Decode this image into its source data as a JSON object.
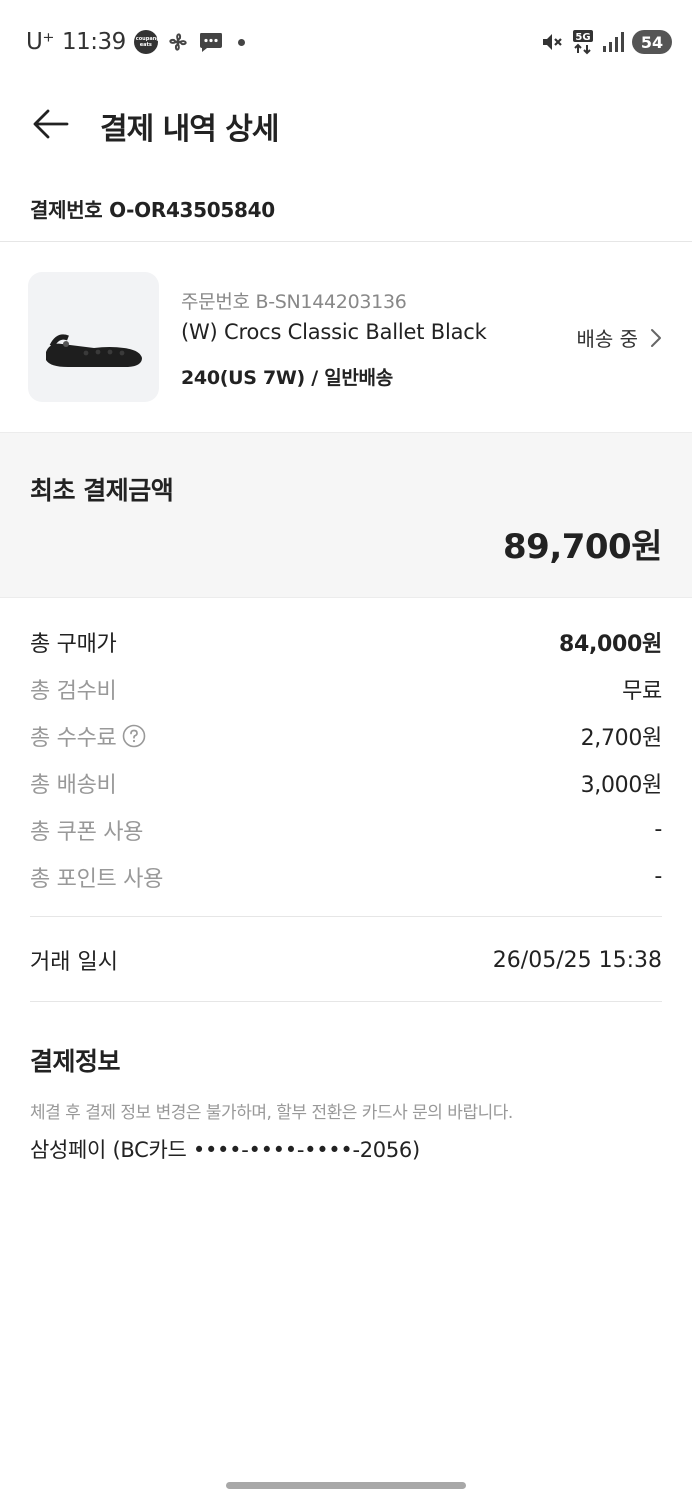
{
  "status_bar": {
    "carrier": "U⁺",
    "time": "11:39",
    "eats_icon_text": "coupang eats",
    "battery": "54",
    "icons": [
      "eats-icon",
      "pinwheel-icon",
      "chat-icon",
      "notification-dot-icon",
      "mute-icon",
      "5g-icon",
      "signal-icon",
      "battery-icon"
    ]
  },
  "header": {
    "title": "결제 내역 상세",
    "back_icon": "arrow-left-icon"
  },
  "payment": {
    "number": "결제번호 O-OR43505840"
  },
  "product": {
    "order_no": "주문번호 B-SN144203136",
    "name": "(W) Crocs Classic Ballet Black",
    "option": "240(US 7W) / 일반배송",
    "status": "배송 중"
  },
  "total": {
    "label": "최초 결제금액",
    "amount": "89,700원"
  },
  "breakdown": [
    {
      "label": "총 구매가",
      "value": "84,000원"
    },
    {
      "label": "총 검수비",
      "value": "무료"
    },
    {
      "label": "총 수수료",
      "value": "2,700원"
    },
    {
      "label": "총 배송비",
      "value": "3,000원"
    },
    {
      "label": "총 쿠폰 사용",
      "value": "-"
    },
    {
      "label": "총 포인트 사용",
      "value": "-"
    }
  ],
  "transaction": {
    "label": "거래 일시",
    "value": "26/05/25 15:38"
  },
  "payment_info": {
    "title": "결제정보",
    "note": "체결 후 결제 정보 변경은 불가하며, 할부 전환은 카드사 문의 바랍니다.",
    "method": "삼성페이 (BC카드 ••••-••••-••••-2056)"
  },
  "colors": {
    "text_primary": "#222222",
    "text_secondary": "#999999",
    "summary_bg": "#f6f6f6",
    "divider": "#e6e6e6"
  }
}
